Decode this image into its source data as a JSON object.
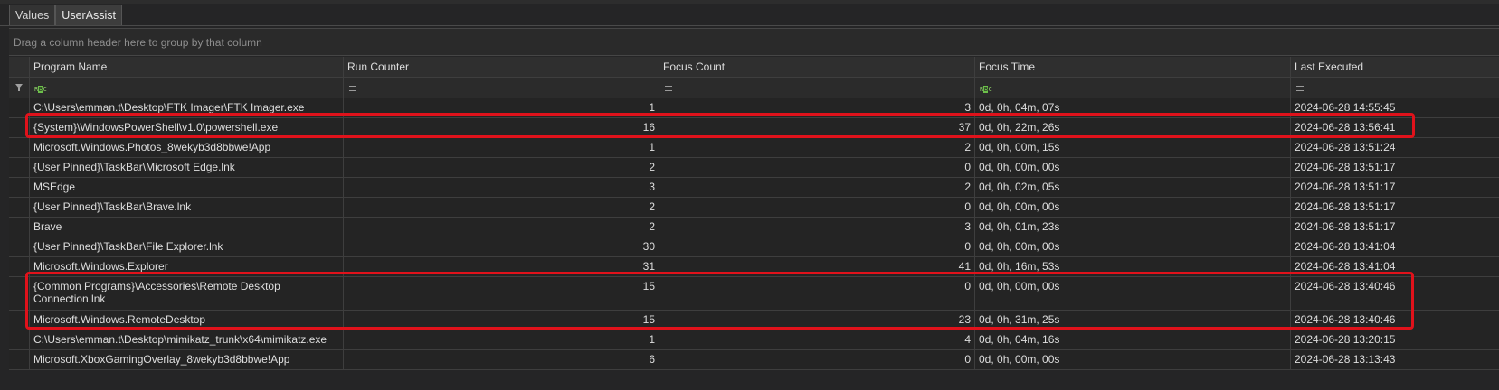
{
  "tabs": {
    "values": "Values",
    "userassist": "UserAssist"
  },
  "group_panel": {
    "hint": "Drag a column header here to group by that column"
  },
  "columns": {
    "program_name": "Program Name",
    "run_counter": "Run Counter",
    "focus_count": "Focus Count",
    "focus_time": "Focus Time",
    "last_executed": "Last Executed"
  },
  "filter_row": {
    "text_filter_icon": "RBC-icon",
    "equals_filter_icon": "equals-icon"
  },
  "rows": [
    {
      "program": "C:\\Users\\emman.t\\Desktop\\FTK Imager\\FTK Imager.exe",
      "run": "1",
      "focus": "3",
      "time": "0d, 0h, 04m, 07s",
      "last": "2024-06-28 14:55:45"
    },
    {
      "program": "{System}\\WindowsPowerShell\\v1.0\\powershell.exe",
      "run": "16",
      "focus": "37",
      "time": "0d, 0h, 22m, 26s",
      "last": "2024-06-28 13:56:41"
    },
    {
      "program": "Microsoft.Windows.Photos_8wekyb3d8bbwe!App",
      "run": "1",
      "focus": "2",
      "time": "0d, 0h, 00m, 15s",
      "last": "2024-06-28 13:51:24"
    },
    {
      "program": "{User Pinned}\\TaskBar\\Microsoft Edge.lnk",
      "run": "2",
      "focus": "0",
      "time": "0d, 0h, 00m, 00s",
      "last": "2024-06-28 13:51:17"
    },
    {
      "program": "MSEdge",
      "run": "3",
      "focus": "2",
      "time": "0d, 0h, 02m, 05s",
      "last": "2024-06-28 13:51:17"
    },
    {
      "program": "{User Pinned}\\TaskBar\\Brave.lnk",
      "run": "2",
      "focus": "0",
      "time": "0d, 0h, 00m, 00s",
      "last": "2024-06-28 13:51:17"
    },
    {
      "program": "Brave",
      "run": "2",
      "focus": "3",
      "time": "0d, 0h, 01m, 23s",
      "last": "2024-06-28 13:51:17"
    },
    {
      "program": "{User Pinned}\\TaskBar\\File Explorer.lnk",
      "run": "30",
      "focus": "0",
      "time": "0d, 0h, 00m, 00s",
      "last": "2024-06-28 13:41:04"
    },
    {
      "program": "Microsoft.Windows.Explorer",
      "run": "31",
      "focus": "41",
      "time": "0d, 0h, 16m, 53s",
      "last": "2024-06-28 13:41:04"
    },
    {
      "program": "{Common Programs}\\Accessories\\Remote Desktop Connection.lnk",
      "run": "15",
      "focus": "0",
      "time": "0d, 0h, 00m, 00s",
      "last": "2024-06-28 13:40:46"
    },
    {
      "program": "Microsoft.Windows.RemoteDesktop",
      "run": "15",
      "focus": "23",
      "time": "0d, 0h, 31m, 25s",
      "last": "2024-06-28 13:40:46"
    },
    {
      "program": "C:\\Users\\emman.t\\Desktop\\mimikatz_trunk\\x64\\mimikatz.exe",
      "run": "1",
      "focus": "4",
      "time": "0d, 0h, 04m, 16s",
      "last": "2024-06-28 13:20:15"
    },
    {
      "program": "Microsoft.XboxGamingOverlay_8wekyb3d8bbwe!App",
      "run": "6",
      "focus": "0",
      "time": "0d, 0h, 00m, 00s",
      "last": "2024-06-28 13:13:43"
    }
  ],
  "highlight_color": "#e0121b"
}
